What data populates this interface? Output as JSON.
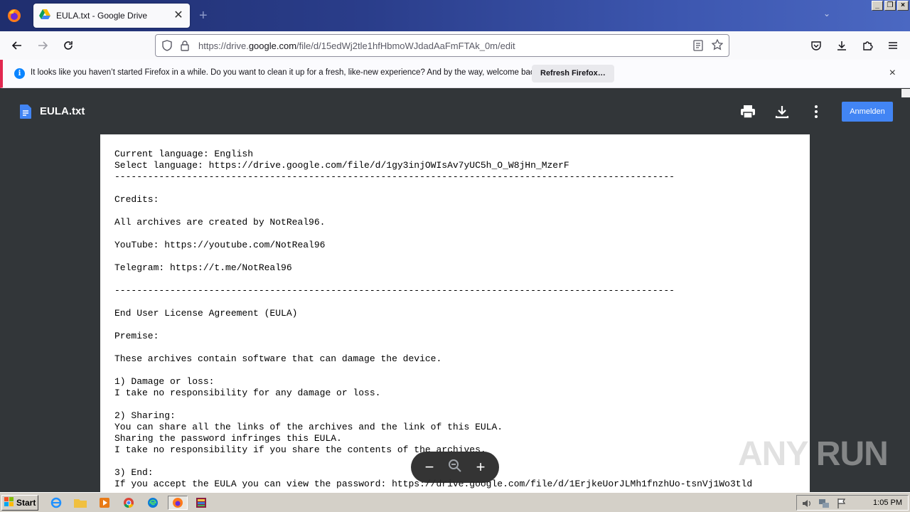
{
  "browser": {
    "tab": {
      "title": "EULA.txt - Google Drive"
    },
    "new_tab_label": "+",
    "url_prefix": "https://drive.",
    "url_domain": "google.com",
    "url_path": "/file/d/15edWj2tle1hfHbmoWJdadAaFmFTAk_0m/edit"
  },
  "notification": {
    "message": "It looks like you haven’t started Firefox in a while. Do you want to clean it up for a fresh, like-new experience? And by the way, welcome back!",
    "refresh_label": "Refresh Firefox…",
    "close_label": "×"
  },
  "viewer": {
    "filename": "EULA.txt",
    "signin_label": "Anmelden",
    "content": "Current language: English\nSelect language: https://drive.google.com/file/d/1gy3injOWIsAv7yUC5h_O_W8jHn_MzerF\n-----------------------------------------------------------------------------------------------------\n\nCredits:\n\nAll archives are created by NotReal96.\n\nYouTube: https://youtube.com/NotReal96\n\nTelegram: https://t.me/NotReal96\n\n-----------------------------------------------------------------------------------------------------\n\nEnd User License Agreement (EULA)\n\nPremise:\n\nThese archives contain software that can damage the device.\n\n1) Damage or loss:\nI take no responsibility for any damage or loss.\n\n2) Sharing:\nYou can share all the links of the archives and the link of this EULA.\nSharing the password infringes this EULA.\nI take no responsibility if you share the contents of the archives.\n\n3) End:\nIf you accept the EULA you can view the password: https://drive.google.com/file/d/1ErjkeUorJLMh1fnzhUo-tsnVj1Wo3tld",
    "zoom_out": "−",
    "zoom_in": "+"
  },
  "watermark": "ANY RUN",
  "taskbar": {
    "start_label": "Start",
    "clock": "1:05 PM"
  },
  "colors": {
    "accent_blue": "#4285f4",
    "notification_border": "#e22850",
    "viewer_bg": "#323639"
  }
}
